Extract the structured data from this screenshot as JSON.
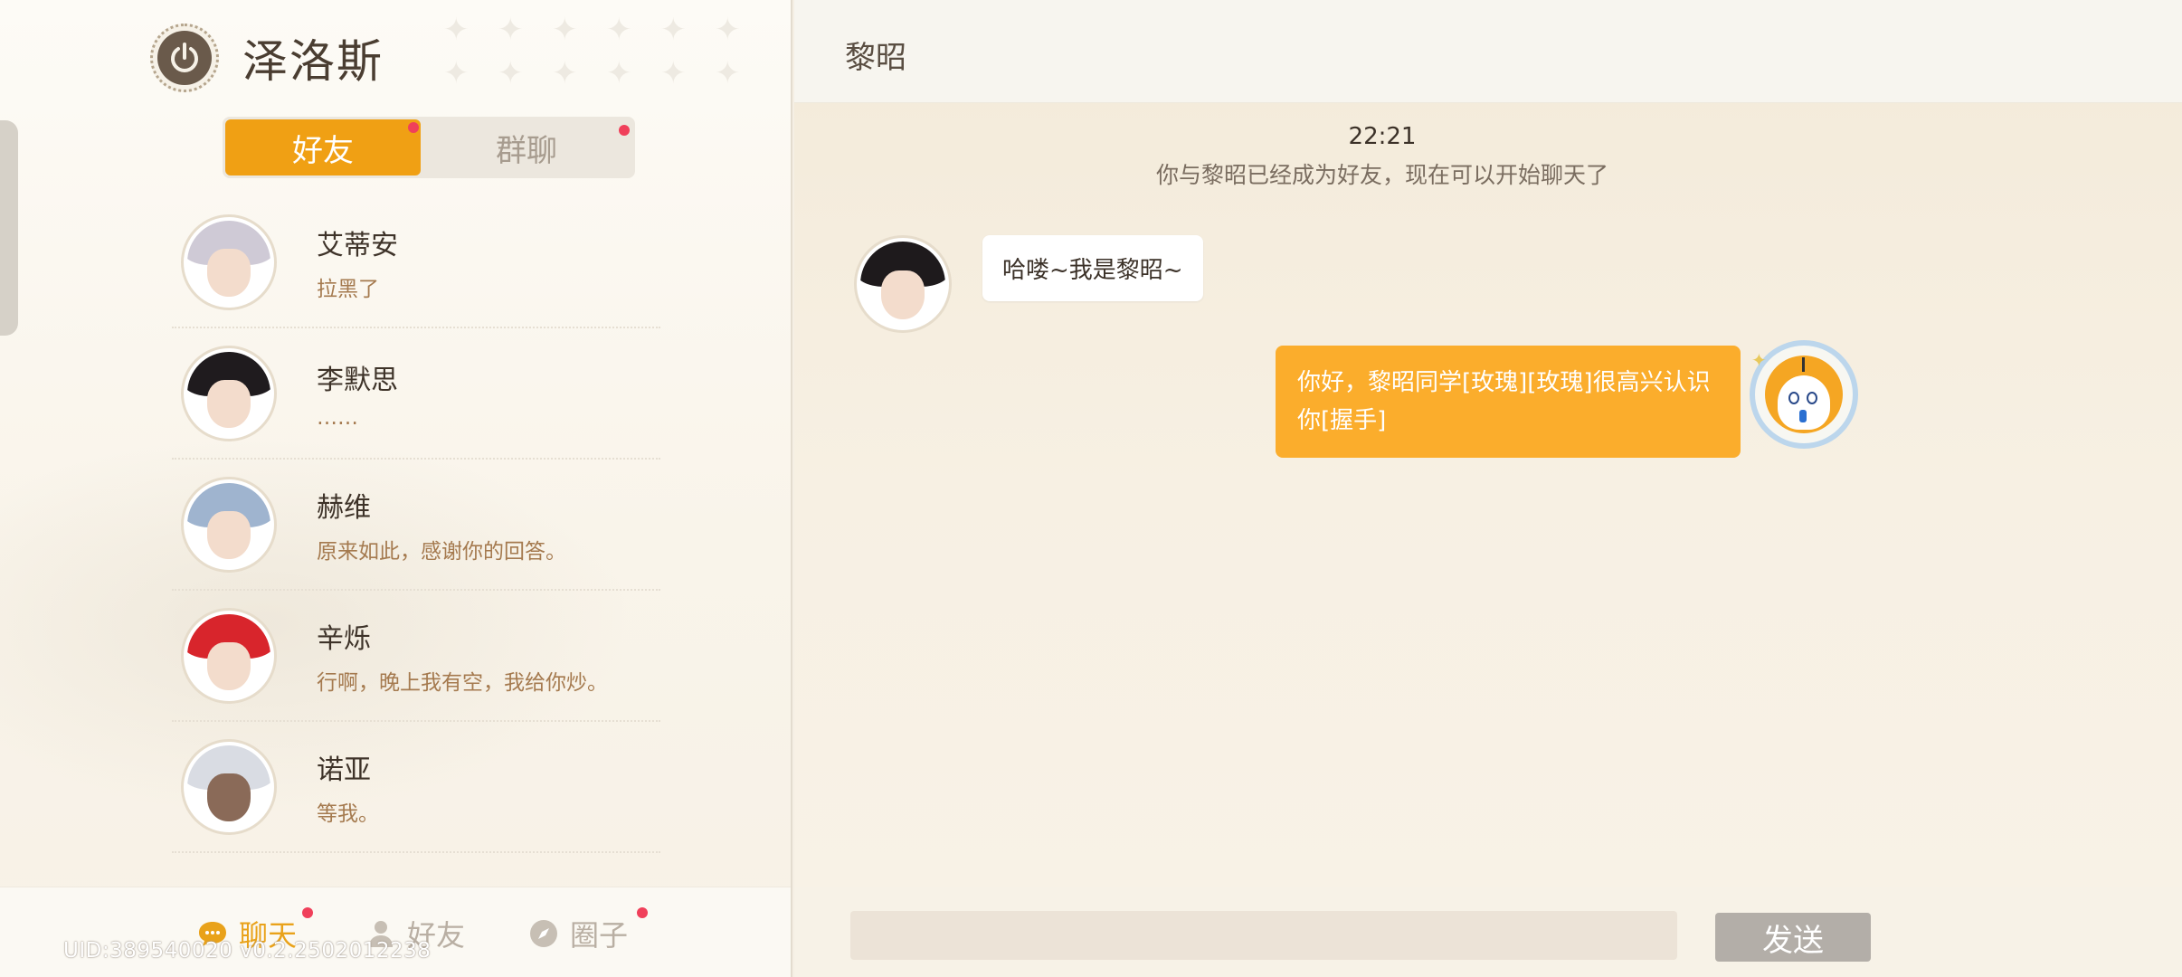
{
  "user": {
    "name": "泽洛斯"
  },
  "segment": {
    "friends_label": "好友",
    "groups_label": "群聊"
  },
  "contacts": [
    {
      "name": "艾蒂安",
      "last_message": "拉黑了",
      "hair_color": "#cfcad6"
    },
    {
      "name": "李默思",
      "last_message": "……",
      "hair_color": "#1f1b1e"
    },
    {
      "name": "赫维",
      "last_message": "原来如此，感谢你的回答。",
      "hair_color": "#9fb4cf"
    },
    {
      "name": "辛烁",
      "last_message": "行啊，晚上我有空，我给你炒。",
      "hair_color": "#d8252c"
    },
    {
      "name": "诺亚",
      "last_message": "等我。",
      "hair_color": "#d9dce3"
    }
  ],
  "bottom_nav": {
    "chat_label": "聊天",
    "friends_label": "好友",
    "circle_label": "圈子"
  },
  "footer": {
    "uid": "UID:389540020 v0.2.2502012238"
  },
  "chat": {
    "title": "黎昭",
    "time": "22:21",
    "system_message": "你与黎昭已经成为好友，现在可以开始聊天了",
    "incoming_message": "哈喽~我是黎昭~",
    "outgoing_message": "你好，黎昭同学[玫瑰][玫瑰]很高兴认识你[握手]",
    "input_value": "",
    "send_label": "发送"
  },
  "colors": {
    "accent": "#f0a014",
    "outgoing_bubble": "#fbad2c",
    "badge": "#f0405a",
    "send_disabled": "#b3aea8"
  }
}
